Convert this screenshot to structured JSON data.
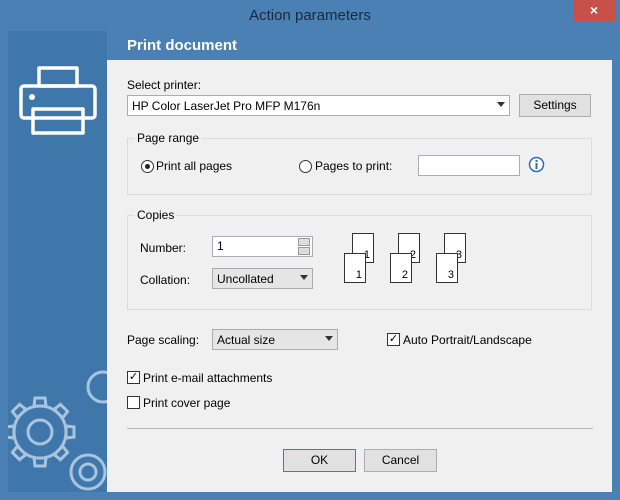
{
  "window": {
    "title": "Action parameters",
    "close_icon": "×"
  },
  "header": {
    "title": "Print document"
  },
  "printer": {
    "label": "Select printer:",
    "selected": "HP Color LaserJet Pro MFP M176n",
    "settings_label": "Settings"
  },
  "page_range": {
    "label": "Page range",
    "all_label": "Print all pages",
    "pages_label": "Pages to print:",
    "pages_value": "",
    "selected": "all"
  },
  "copies": {
    "label": "Copies",
    "number_label": "Number:",
    "number_value": "1",
    "collation_label": "Collation:",
    "collation_value": "Uncollated",
    "stacks": [
      [
        "1",
        "1"
      ],
      [
        "2",
        "2"
      ],
      [
        "3",
        "3"
      ]
    ]
  },
  "scaling": {
    "label": "Page scaling:",
    "value": "Actual size",
    "auto_label": "Auto Portrait/Landscape",
    "auto_checked": true
  },
  "email": {
    "label": "Print e-mail attachments",
    "checked": true
  },
  "cover": {
    "label": "Print cover page",
    "checked": false
  },
  "buttons": {
    "ok": "OK",
    "cancel": "Cancel"
  },
  "colors": {
    "accent": "#4a80b3",
    "sidebar": "#3f77ab",
    "close": "#c7504b"
  }
}
